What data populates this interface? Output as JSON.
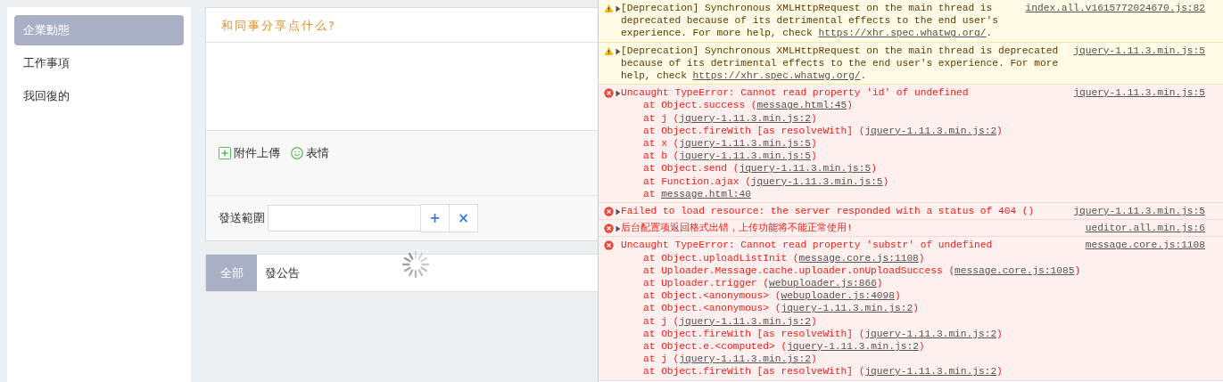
{
  "sidebar": {
    "items": [
      {
        "label": "企業動態",
        "selected": true
      },
      {
        "label": "工作事項",
        "selected": false
      },
      {
        "label": "我回復的",
        "selected": false
      }
    ]
  },
  "composer": {
    "title": "和同事分享点什么?",
    "toolbar": [
      {
        "kind": "attach",
        "label": "附件上傳"
      },
      {
        "kind": "emoji",
        "label": "表情"
      }
    ],
    "scope": {
      "label": "發送範圍",
      "add": "+",
      "clear": "×"
    }
  },
  "feed_tabs": [
    {
      "label": "全部",
      "selected": true
    },
    {
      "label": "發公告",
      "selected": false
    }
  ],
  "console": {
    "messages": [
      {
        "kind": "warning",
        "expandable": true,
        "text": "[Deprecation] Synchronous XMLHttpRequest on the main thread is deprecated because of its detrimental effects to the end user's experience. For more help, check ",
        "link": "https://xhr.spec.whatwg.org/",
        "after": ".",
        "source": "index.all.v1615772024670.js:82"
      },
      {
        "kind": "warning",
        "expandable": true,
        "text": "[Deprecation] Synchronous XMLHttpRequest on the main thread is deprecated because of its detrimental effects to the end user's experience. For more help, check ",
        "link": "https://xhr.spec.whatwg.org/",
        "after": ".",
        "source": "jquery-1.11.3.min.js:5"
      },
      {
        "kind": "error",
        "expandable": true,
        "text": "Uncaught TypeError: Cannot read property 'id' of undefined",
        "source": "jquery-1.11.3.min.js:5",
        "frames": [
          {
            "before": "at Object.success (",
            "link": "message.html:45",
            "after": ")"
          },
          {
            "before": "at j (",
            "link": "jquery-1.11.3.min.js:2",
            "after": ")"
          },
          {
            "before": "at Object.fireWith [as resolveWith] (",
            "link": "jquery-1.11.3.min.js:2",
            "after": ")"
          },
          {
            "before": "at x (",
            "link": "jquery-1.11.3.min.js:5",
            "after": ")"
          },
          {
            "before": "at b (",
            "link": "jquery-1.11.3.min.js:5",
            "after": ")"
          },
          {
            "before": "at Object.send (",
            "link": "jquery-1.11.3.min.js:5",
            "after": ")"
          },
          {
            "before": "at Function.ajax (",
            "link": "jquery-1.11.3.min.js:5",
            "after": ")"
          },
          {
            "before": "at ",
            "link": "message.html:40"
          }
        ]
      },
      {
        "kind": "error",
        "expandable": true,
        "text": "Failed to load resource: the server responded with a status of 404 ()",
        "source": "jquery-1.11.3.min.js:5"
      },
      {
        "kind": "error",
        "expandable": true,
        "text": "后台配置项返回格式出错，上传功能将不能正常使用!",
        "source": "ueditor.all.min.js:6"
      },
      {
        "kind": "error",
        "expandable": false,
        "text": "Uncaught TypeError: Cannot read property 'substr' of undefined",
        "source": "message.core.js:1108",
        "frames": [
          {
            "before": "at Object.uploadListInit (",
            "link": "message.core.js:1108",
            "after": ")"
          },
          {
            "before": "at Uploader.Message.cache.uploader.onUploadSuccess (",
            "link": "message.core.js:1085",
            "after": ")"
          },
          {
            "before": "at Uploader.trigger (",
            "link": "webuploader.js:866",
            "after": ")"
          },
          {
            "before": "at Object.<anonymous> (",
            "link": "webuploader.js:4098",
            "after": ")"
          },
          {
            "before": "at Object.<anonymous> (",
            "link": "jquery-1.11.3.min.js:2",
            "after": ")"
          },
          {
            "before": "at j (",
            "link": "jquery-1.11.3.min.js:2",
            "after": ")"
          },
          {
            "before": "at Object.fireWith [as resolveWith] (",
            "link": "jquery-1.11.3.min.js:2",
            "after": ")"
          },
          {
            "before": "at Object.e.<computed> (",
            "link": "jquery-1.11.3.min.js:2",
            "after": ")"
          },
          {
            "before": "at j (",
            "link": "jquery-1.11.3.min.js:2",
            "after": ")"
          },
          {
            "before": "at Object.fireWith [as resolveWith] (",
            "link": "jquery-1.11.3.min.js:2",
            "after": ")"
          }
        ]
      }
    ]
  }
}
